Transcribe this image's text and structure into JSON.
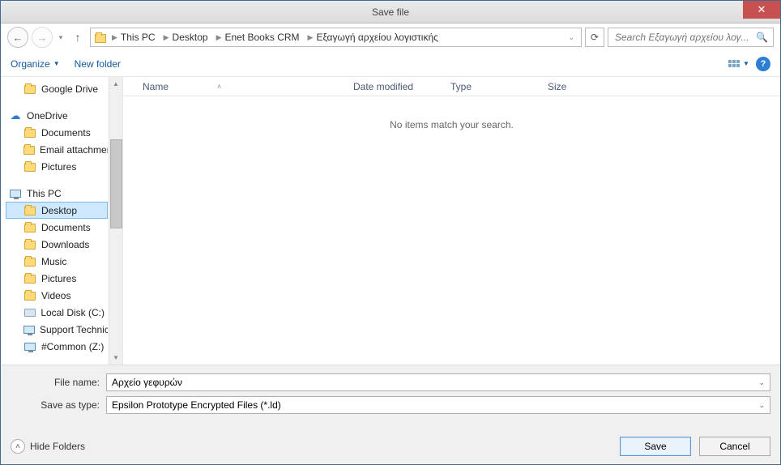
{
  "title": "Save file",
  "breadcrumbs": [
    "This PC",
    "Desktop",
    "Enet Books CRM",
    "Εξαγωγή αρχείου λογιστικής"
  ],
  "search": {
    "placeholder": "Search Εξαγωγή αρχείου λογ..."
  },
  "toolbar": {
    "organize": "Organize",
    "newfolder": "New folder"
  },
  "columns": {
    "name": "Name",
    "date": "Date modified",
    "type": "Type",
    "size": "Size"
  },
  "empty_message": "No items match your search.",
  "tree": {
    "googledrive": "Google Drive",
    "onedrive": "OneDrive",
    "od_documents": "Documents",
    "od_email": "Email attachmen",
    "od_pictures": "Pictures",
    "thispc": "This PC",
    "desktop": "Desktop",
    "documents": "Documents",
    "downloads": "Downloads",
    "music": "Music",
    "pictures": "Pictures",
    "videos": "Videos",
    "localdisk": "Local Disk (C:)",
    "support": "Support Technica",
    "common": "#Common (Z:)"
  },
  "form": {
    "filename_label": "File name:",
    "filename_value": "Αρχείο γεφυρών",
    "saveas_label": "Save as type:",
    "saveas_value": "Epsilon Prototype Encrypted Files (*.ld)",
    "hide_folders": "Hide Folders",
    "save": "Save",
    "cancel": "Cancel"
  }
}
